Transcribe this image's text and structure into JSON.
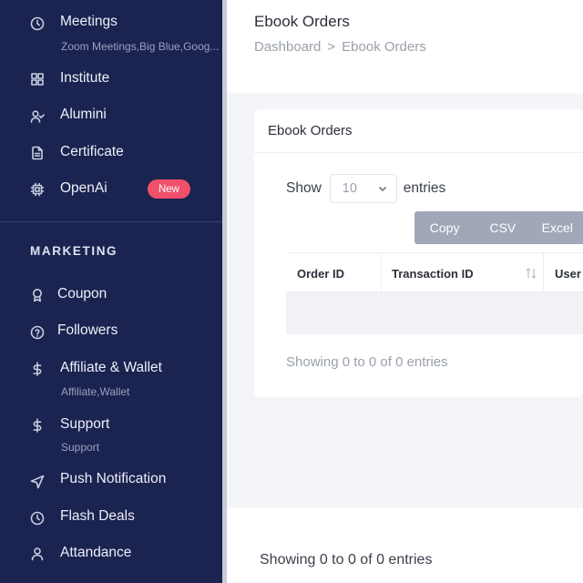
{
  "sidebar": {
    "items": [
      {
        "label": "Meetings",
        "sub": "Zoom Meetings,Big Blue,Goog...",
        "icon": "clock-icon"
      },
      {
        "label": "Institute",
        "icon": "grid-icon"
      },
      {
        "label": "Alumini",
        "icon": "user-check-icon"
      },
      {
        "label": "Certificate",
        "icon": "file-text-icon"
      },
      {
        "label": "OpenAi",
        "badge": "New",
        "icon": "cpu-icon"
      }
    ],
    "section_title": "MARKETING",
    "marketing_items": [
      {
        "label": "Coupon",
        "icon": "award-icon"
      },
      {
        "label": "Followers",
        "icon": "help-circle-icon"
      },
      {
        "label": "Affiliate & Wallet",
        "sub": "Affiliate,Wallet",
        "icon": "dollar-icon"
      },
      {
        "label": "Support",
        "sub": "Support",
        "icon": "dollar-icon"
      },
      {
        "label": "Push Notification",
        "icon": "navigation-icon"
      },
      {
        "label": "Flash Deals",
        "icon": "clock-icon"
      },
      {
        "label": "Attandance",
        "icon": "user-icon"
      }
    ]
  },
  "header": {
    "title": "Ebook Orders",
    "breadcrumb": [
      "Dashboard",
      ">",
      "Ebook Orders"
    ]
  },
  "card": {
    "title": "Ebook Orders",
    "show_label": "Show",
    "entries_label": "entries",
    "page_size": "10",
    "buttons": [
      "Copy",
      "CSV",
      "Excel"
    ],
    "columns": [
      "Order ID",
      "Transaction ID",
      "User"
    ],
    "info": "Showing 0 to 0 of 0 entries"
  },
  "footer": {
    "info": "Showing 0 to 0 of 0 entries"
  },
  "colors": {
    "sidebar_bg": "#1b2350",
    "badge": "#f1506a",
    "button_group": "#9fa7b8"
  }
}
